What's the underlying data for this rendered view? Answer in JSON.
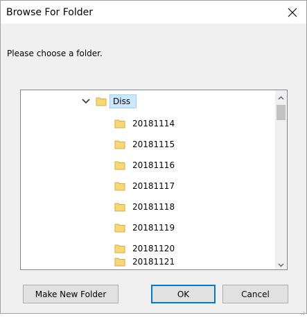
{
  "dialog": {
    "title": "Browse For Folder",
    "prompt": "Please choose a folder."
  },
  "tree": {
    "root": {
      "label": "Diss",
      "expanded": true,
      "selected": true
    },
    "children": [
      "20181114",
      "20181115",
      "20181116",
      "20181117",
      "20181118",
      "20181119",
      "20181120",
      "20181121"
    ]
  },
  "buttons": {
    "make_new_folder": "Make New Folder",
    "ok": "OK",
    "cancel": "Cancel"
  },
  "icons": {
    "close": "close-icon",
    "folder": "folder-icon",
    "expander": "chevron-down-icon",
    "scroll_up": "chevron-up-icon",
    "scroll_down": "chevron-down-icon"
  },
  "colors": {
    "selection_fill": "#cce8ff",
    "selection_border": "#99d1ff",
    "folder_fill": "#f8d775",
    "default_button_border": "#0078d7"
  }
}
